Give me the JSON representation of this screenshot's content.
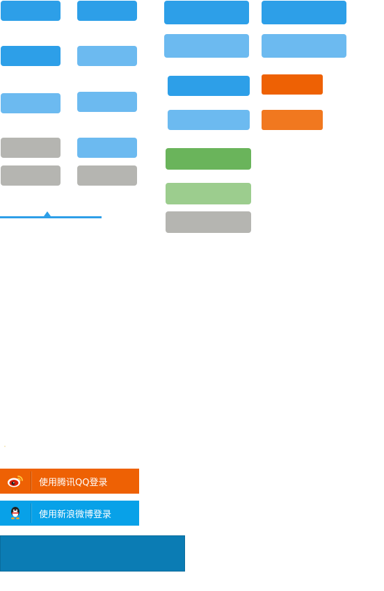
{
  "social_login": {
    "qq_label": "使用腾讯QQ登录",
    "weibo_label": "使用新浪微博登录",
    "qq_icon": "weibo-icon",
    "weibo_icon": "qq-penguin-icon"
  },
  "colors": {
    "blue": "#2d9fe8",
    "blue_light": "#6cbaf0",
    "gray": "#b5b5b1",
    "orange": "#ee6104",
    "orange_light": "#f1781f",
    "green": "#6ab45b",
    "green_light": "#9ccd8e",
    "social_orange": "#ee6104",
    "social_blue": "#08a1e8",
    "dark_teal": "#0b7cb4"
  }
}
